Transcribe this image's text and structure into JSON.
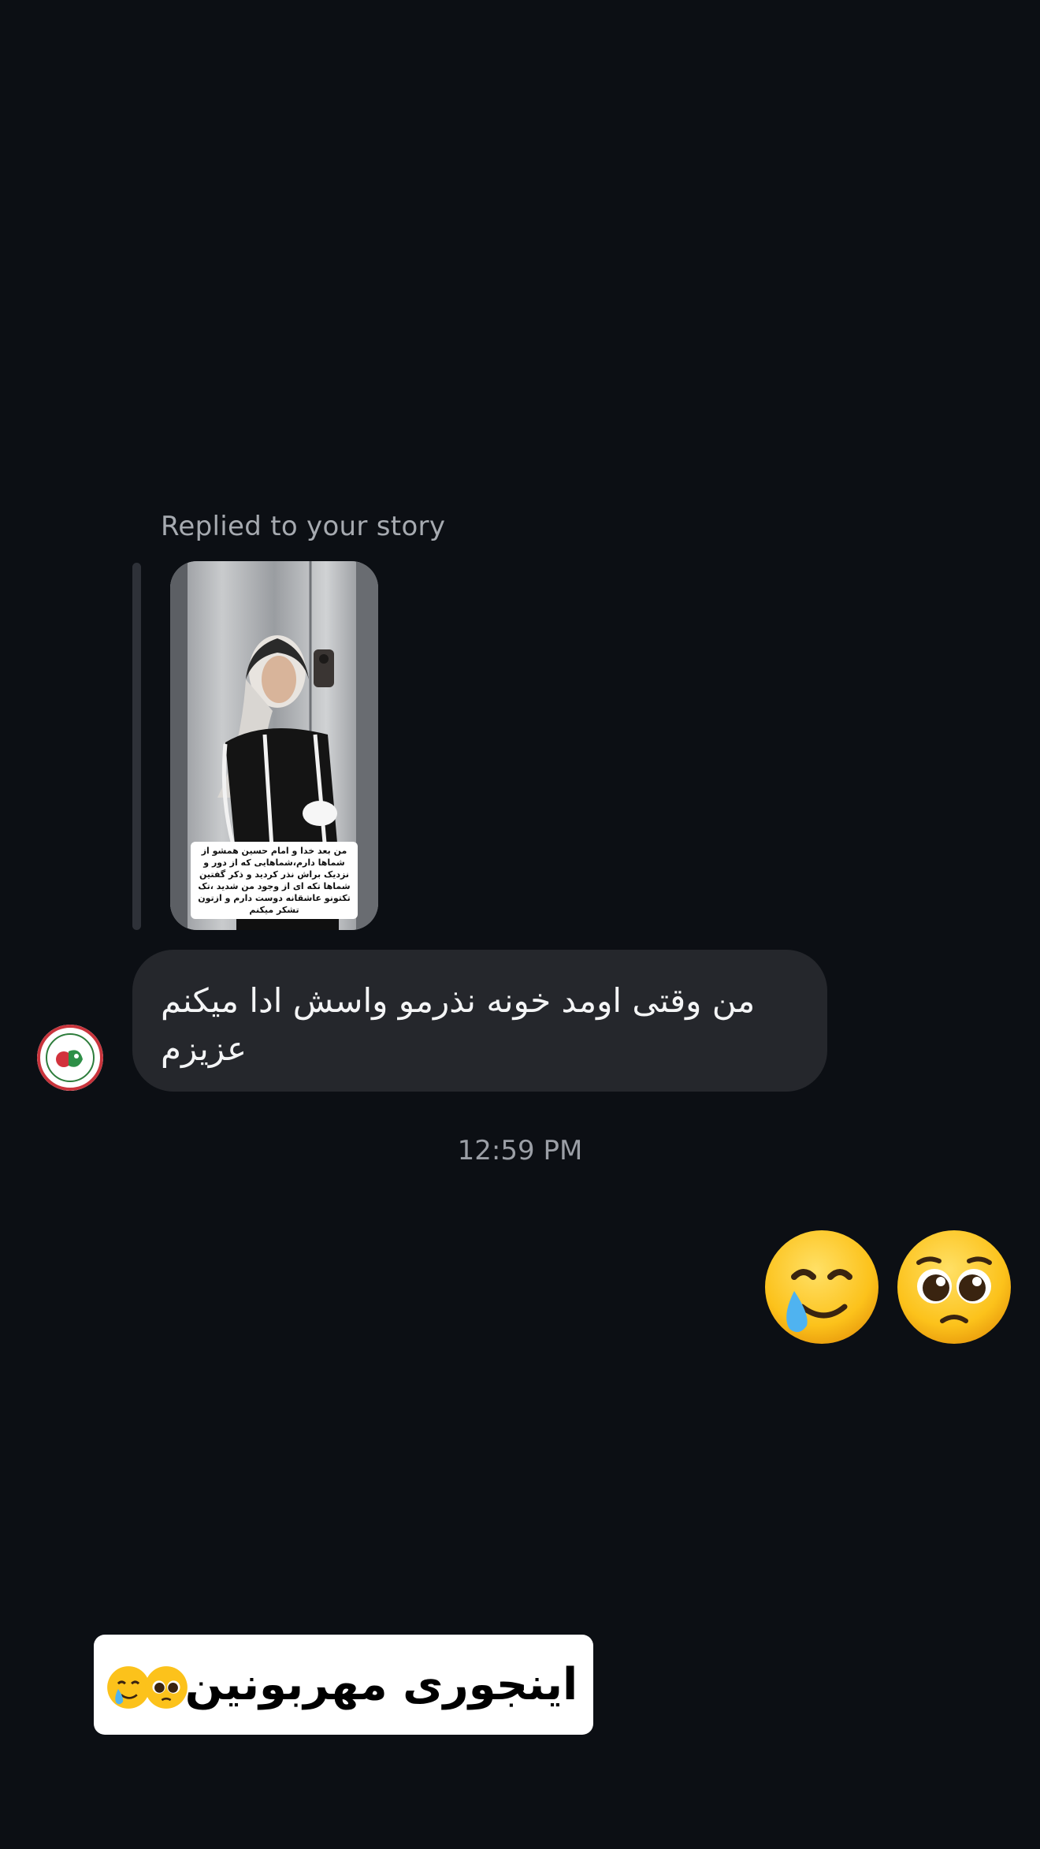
{
  "reply": {
    "header": "Replied to your story",
    "story_caption": "من بعد خدا و امام حسین همشو از شماها دارم،شماهایی که از دور و نزدیک براش نذر کردید و ذکر گفتین شماها تکه ای از وجود من شدید ،تک تکتونو عاشقانه دوست دارم و ازتون تشکر میکنم"
  },
  "message": {
    "text": "من وقتی اومد خونه نذرمو واسش ادا میکنم عزیزم"
  },
  "timestamp": "12:59 PM",
  "sent_emojis": [
    "smiling-face-with-tear",
    "pleading-face"
  ],
  "overlay_caption": {
    "text": "اینجوری مهربونین"
  },
  "colors": {
    "background": "#0c0f14",
    "bubble": "#25272c",
    "emoji_yellow": "#fcc21b"
  }
}
